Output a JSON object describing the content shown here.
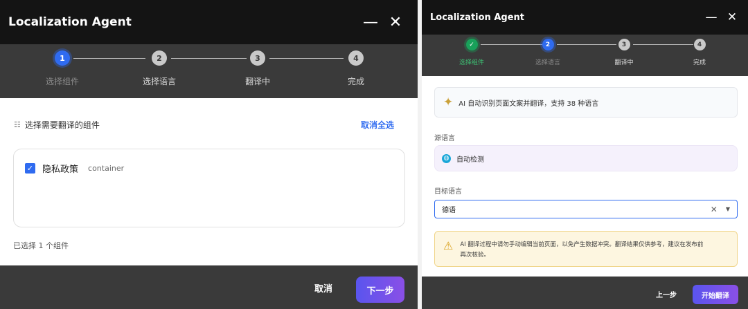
{
  "left": {
    "title": "Localization Agent",
    "minimize_glyph": "—",
    "close_glyph": "✕",
    "steps": [
      {
        "num": "1",
        "label": "选择组件",
        "state": "active"
      },
      {
        "num": "2",
        "label": "选择语言",
        "state": "idle"
      },
      {
        "num": "3",
        "label": "翻译中",
        "state": "idle"
      },
      {
        "num": "4",
        "label": "完成",
        "state": "idle"
      }
    ],
    "section_title": "选择需要翻译的组件",
    "deselect_all": "取消全选",
    "components": [
      {
        "name": "隐私政策",
        "type": "container",
        "checked": true
      }
    ],
    "selected_count": "已选择 1 个组件",
    "cancel_label": "取消",
    "next_label": "下一步"
  },
  "right": {
    "title": "Localization Agent",
    "minimize_glyph": "—",
    "close_glyph": "✕",
    "steps": [
      {
        "num": "✓",
        "label": "选择组件",
        "state": "done"
      },
      {
        "num": "2",
        "label": "选择语言",
        "state": "active"
      },
      {
        "num": "3",
        "label": "翻译中",
        "state": "idle"
      },
      {
        "num": "4",
        "label": "完成",
        "state": "idle"
      }
    ],
    "info_text": "AI 自动识别页面文案并翻译，支持 38 种语言",
    "source_label": "源语言",
    "source_value": "自动检测",
    "target_label": "目标语言",
    "target_value": "德语",
    "warning_line1": "AI 翻译过程中请勿手动编辑当前页面，以免产生数据冲突。翻译结果仅供参考，建议在发布前",
    "warning_line2": "再次核验。",
    "prev_label": "上一步",
    "start_label": "开始翻译"
  },
  "colors": {
    "accent": "#2f6bf0",
    "done": "#19a15a",
    "titlebar": "#141414",
    "panel": "#3a3a3a",
    "button_gradient_start": "#5a55ee",
    "button_gradient_end": "#8a4fe6",
    "warning_bg": "#fdf6e0"
  }
}
